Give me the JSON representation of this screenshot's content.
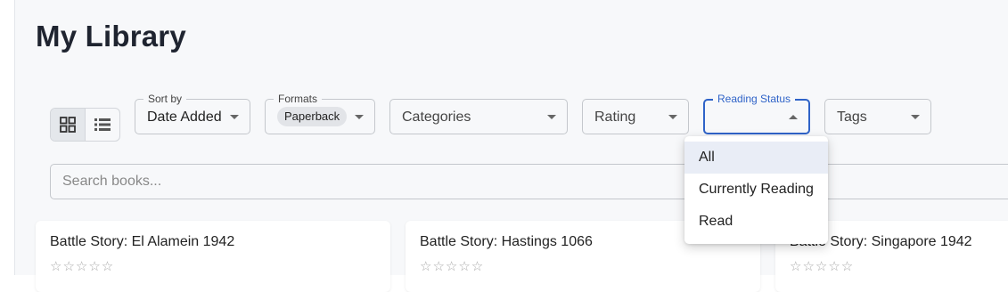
{
  "page": {
    "title": "My Library"
  },
  "filters": {
    "sort": {
      "legend": "Sort by",
      "value": "Date Added"
    },
    "formats": {
      "legend": "Formats",
      "chip": "Paperback"
    },
    "categories": {
      "placeholder": "Categories"
    },
    "rating": {
      "placeholder": "Rating"
    },
    "reading_status": {
      "legend": "Reading Status",
      "value": ""
    },
    "tags": {
      "placeholder": "Tags"
    }
  },
  "search": {
    "placeholder": "Search books..."
  },
  "dropdown": {
    "items": [
      {
        "label": "All",
        "selected": true
      },
      {
        "label": "Currently Reading",
        "selected": false
      },
      {
        "label": "Read",
        "selected": false
      }
    ]
  },
  "books": [
    {
      "title": "Battle Story: El Alamein 1942",
      "stars": "☆☆☆☆☆"
    },
    {
      "title": "Battle Story: Hastings 1066",
      "stars": "☆☆☆☆☆"
    },
    {
      "title": "Battle Story: Singapore 1942",
      "stars": "☆☆☆☆☆"
    }
  ],
  "colors": {
    "accent": "#2f63c8",
    "background": "#f7f8fa"
  },
  "icons": {
    "grid_view": "grid-view-icon",
    "list_view": "list-view-icon"
  }
}
